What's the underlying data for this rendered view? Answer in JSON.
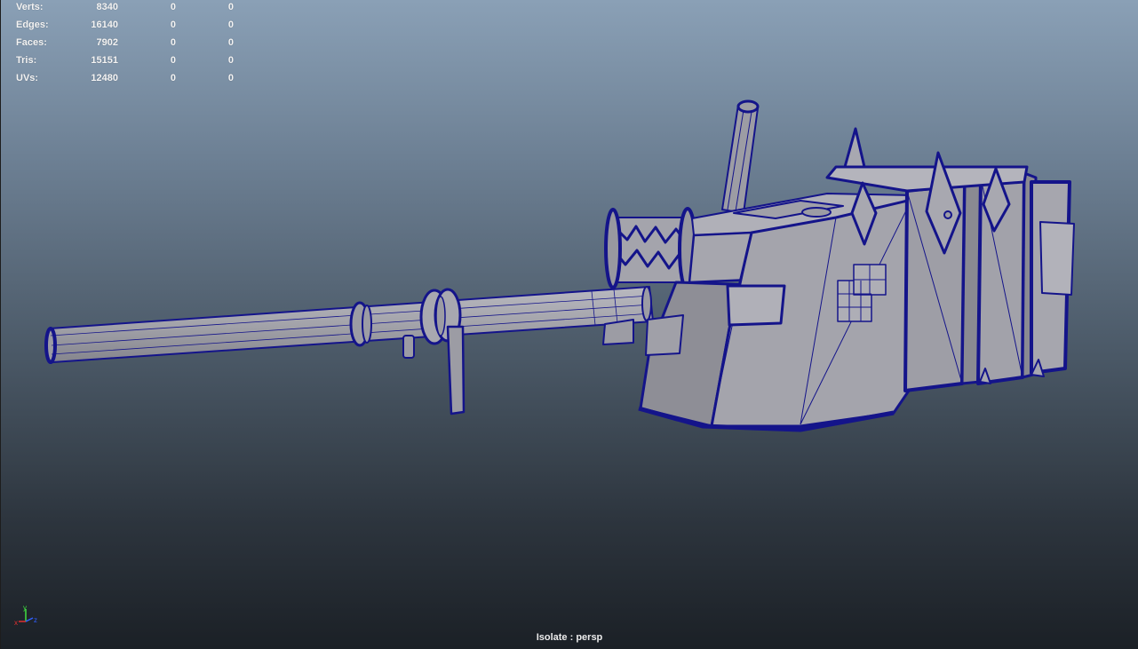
{
  "heads_up_display": {
    "rows": [
      {
        "label": "Verts:",
        "total": "8340",
        "selected": "0",
        "component": "0"
      },
      {
        "label": "Edges:",
        "total": "16140",
        "selected": "0",
        "component": "0"
      },
      {
        "label": "Faces:",
        "total": "7902",
        "selected": "0",
        "component": "0"
      },
      {
        "label": "Tris:",
        "total": "15151",
        "selected": "0",
        "component": "0"
      },
      {
        "label": "UVs:",
        "total": "12480",
        "selected": "0",
        "component": "0"
      }
    ]
  },
  "axis_indicator": {
    "x": "x",
    "y": "y",
    "z": "z"
  },
  "viewport": {
    "isolate_label": "Isolate : persp",
    "colors": {
      "background_top": "#8aa0b6",
      "background_bottom": "#1b2026",
      "wireframe": "#14148a",
      "shaded_surface": "#9c9ca4",
      "axis_x": "#e03030",
      "axis_y": "#40e040",
      "axis_z": "#3060ff"
    }
  }
}
